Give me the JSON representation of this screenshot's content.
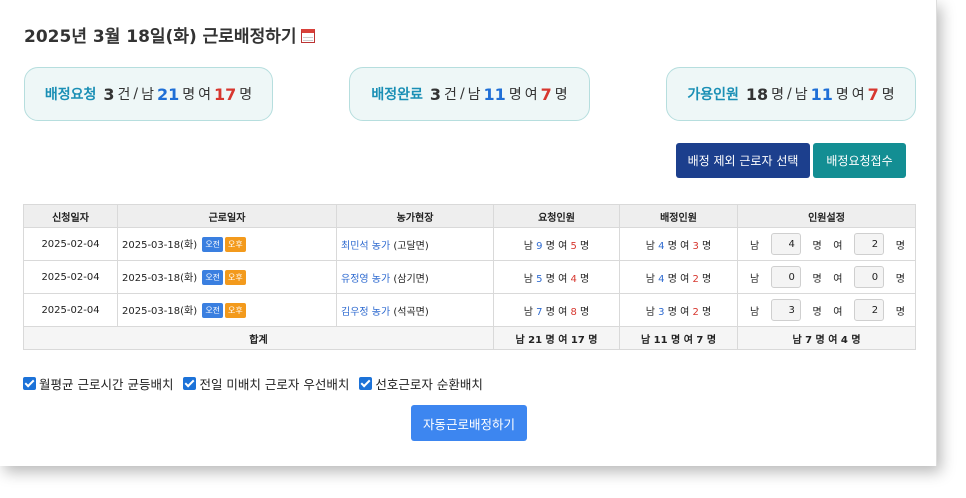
{
  "header": {
    "title": "2025년 3월 18일(화) 근로배정하기"
  },
  "cards": [
    {
      "label": "배정요청",
      "count": "3",
      "unit": "건",
      "male_label": "남",
      "male": "21",
      "person": "명",
      "female_label": "여",
      "female": "17",
      "person2": "명"
    },
    {
      "label": "배정완료",
      "count": "3",
      "unit": "건",
      "male_label": "남",
      "male": "11",
      "person": "명",
      "female_label": "여",
      "female": "7",
      "person2": "명"
    },
    {
      "label": "가용인원",
      "count": "18",
      "unit": "명",
      "male_label": "남",
      "male": "11",
      "person": "명",
      "female_label": "여",
      "female": "7",
      "person2": "명"
    }
  ],
  "buttons": {
    "exclude": "배정 제외 근로자 선택",
    "accept": "배정요청접수",
    "auto": "자동근로배정하기"
  },
  "table": {
    "headers": [
      "신청일자",
      "근로일자",
      "농가현장",
      "요청인원",
      "배정인원",
      "인원설정"
    ],
    "am": "오전",
    "pm": "오후",
    "male": "남",
    "female": "여",
    "unit": "명",
    "rows": [
      {
        "apply_date": "2025-02-04",
        "work_date": "2025-03-18(화)",
        "farm": "최민석 농가",
        "region": "(고달면)",
        "req_m": "9",
        "req_f": "5",
        "asg_m": "4",
        "asg_f": "3",
        "set_m": "4",
        "set_f": "2"
      },
      {
        "apply_date": "2025-02-04",
        "work_date": "2025-03-18(화)",
        "farm": "유정영 농가",
        "region": "(삼기면)",
        "req_m": "5",
        "req_f": "4",
        "asg_m": "4",
        "asg_f": "2",
        "set_m": "0",
        "set_f": "0"
      },
      {
        "apply_date": "2025-02-04",
        "work_date": "2025-03-18(화)",
        "farm": "김우정 농가",
        "region": "(석곡면)",
        "req_m": "7",
        "req_f": "8",
        "asg_m": "3",
        "asg_f": "2",
        "set_m": "3",
        "set_f": "2"
      }
    ],
    "total": {
      "label": "합계",
      "requested": "남 21 명 여 17 명",
      "assigned": "남 11 명 여 7 명",
      "setting": "남 7 명 여 4 명"
    }
  },
  "options": [
    {
      "label": "월평균 근로시간 균등배치",
      "checked": true
    },
    {
      "label": "전일 미배치 근로자 우선배치",
      "checked": true
    },
    {
      "label": "선호근로자 순환배치",
      "checked": true
    }
  ],
  "colors": {
    "navy": "#1c3f8d",
    "teal": "#138e93",
    "blue": "#3d86f0",
    "accent_blue": "#1f6fd6",
    "accent_red": "#d7372f"
  }
}
